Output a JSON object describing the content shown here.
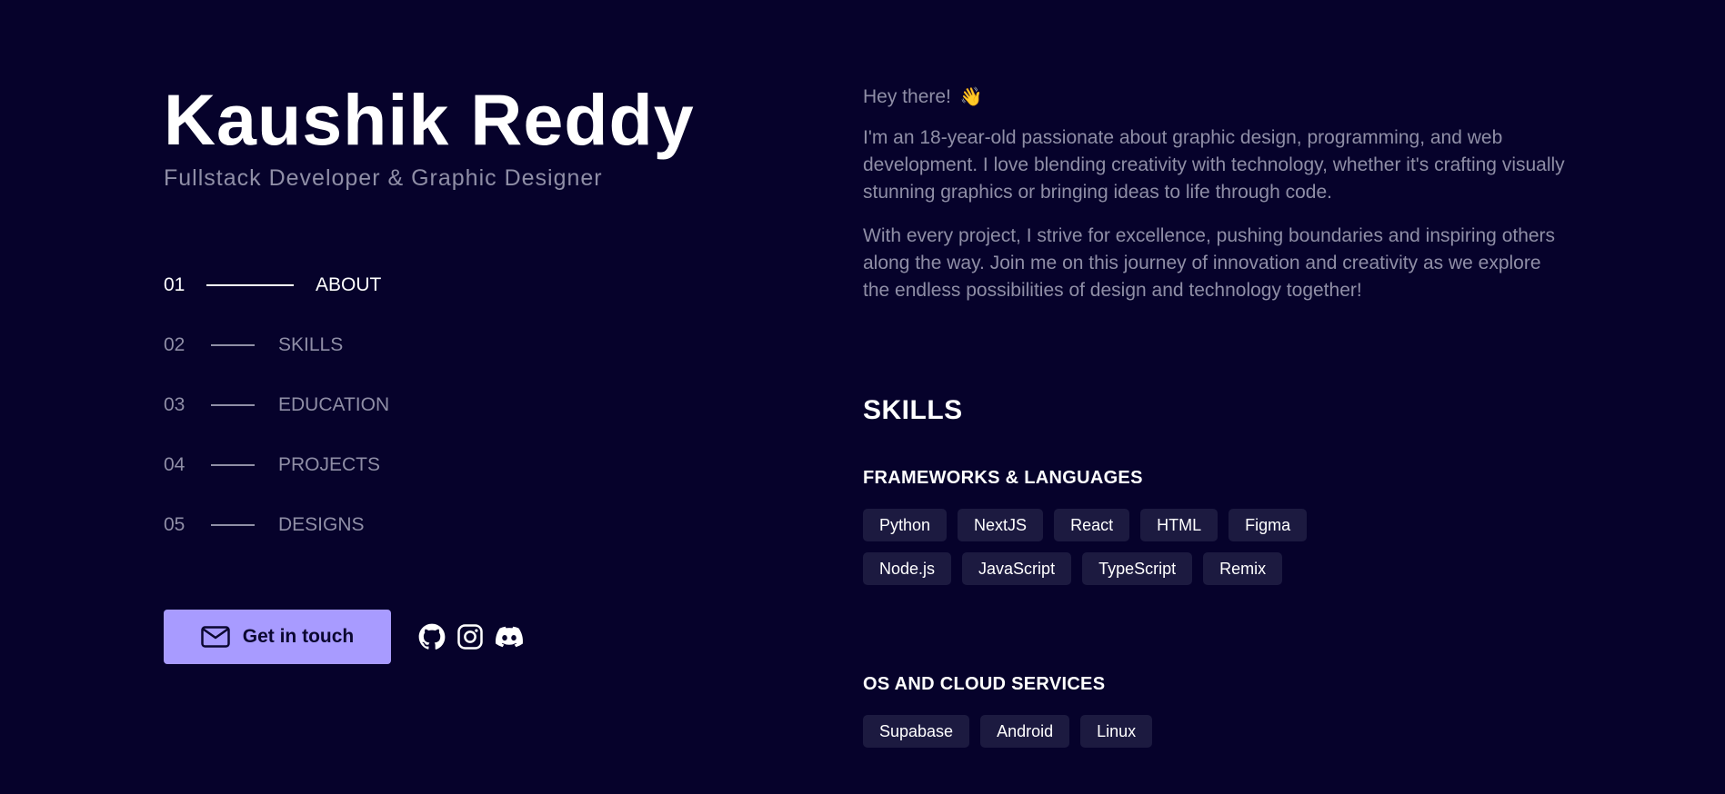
{
  "profile": {
    "name": "Kaushik Reddy",
    "subtitle": "Fullstack Developer & Graphic Designer"
  },
  "nav": [
    {
      "num": "01",
      "label": "ABOUT",
      "active": true
    },
    {
      "num": "02",
      "label": "SKILLS",
      "active": false
    },
    {
      "num": "03",
      "label": "EDUCATION",
      "active": false
    },
    {
      "num": "04",
      "label": "PROJECTS",
      "active": false
    },
    {
      "num": "05",
      "label": "DESIGNS",
      "active": false
    }
  ],
  "cta": {
    "label": "Get in touch",
    "icon": "mail-icon"
  },
  "socials": [
    {
      "name": "github-icon"
    },
    {
      "name": "instagram-icon"
    },
    {
      "name": "discord-icon"
    }
  ],
  "about": {
    "greeting": "Hey there!",
    "wave": "👋",
    "p1": "I'm an 18-year-old passionate about graphic design, programming, and web development. I love blending creativity with technology, whether it's crafting visually stunning graphics or bringing ideas to life through code.",
    "p2": "With every project, I strive for excellence, pushing boundaries and inspiring others along the way. Join me on this journey of innovation and creativity as we explore the endless possibilities of design and technology together!"
  },
  "skills": {
    "title": "SKILLS",
    "groups": [
      {
        "title": "FRAMEWORKS & LANGUAGES",
        "tags": [
          "Python",
          "NextJS",
          "React",
          "HTML",
          "Figma",
          "Node.js",
          "JavaScript",
          "TypeScript",
          "Remix"
        ]
      },
      {
        "title": "OS AND CLOUD SERVICES",
        "tags": [
          "Supabase",
          "Android",
          "Linux"
        ]
      }
    ]
  },
  "colors": {
    "background": "#06022b",
    "accent": "#a89bff",
    "muted": "#8f8ea6",
    "tag_bg": "#1c1a40"
  }
}
